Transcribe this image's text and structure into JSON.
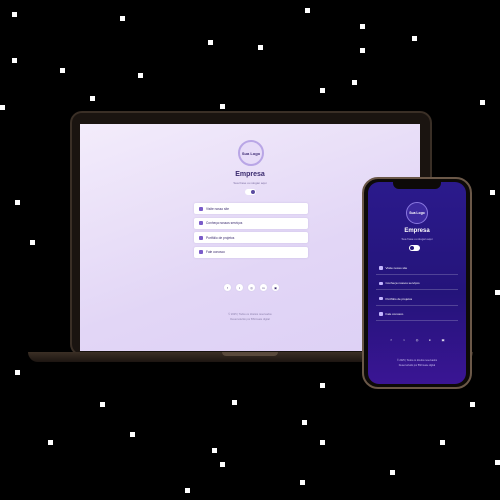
{
  "brand": {
    "logo_text": "Sua Logo",
    "name": "Empresa",
    "slogan": "Sua frase ou slogan aqui"
  },
  "links": [
    {
      "label": "Visite nosso site",
      "icon": "globe-icon"
    },
    {
      "label": "Conheça nossos serviços",
      "icon": "briefcase-icon"
    },
    {
      "label": "Portfólio de projetos",
      "icon": "folder-icon"
    },
    {
      "label": "Fale conosco",
      "icon": "phone-icon"
    }
  ],
  "social": [
    {
      "glyph": "f",
      "icon": "facebook-icon"
    },
    {
      "glyph": "t",
      "icon": "twitter-icon"
    },
    {
      "glyph": "◎",
      "icon": "whatsapp-icon"
    },
    {
      "glyph": "in",
      "icon": "linkedin-icon"
    },
    {
      "glyph": "▣",
      "icon": "instagram-icon"
    }
  ],
  "footer": {
    "copyright": "© 2025 | Todos os direitos reservados",
    "credit": "Desenvolvido por BSCreate digital"
  },
  "colors": {
    "laptop_bg": "#e2d6f6",
    "phone_bg": "#24147a",
    "accent": "#7a5cc9"
  }
}
